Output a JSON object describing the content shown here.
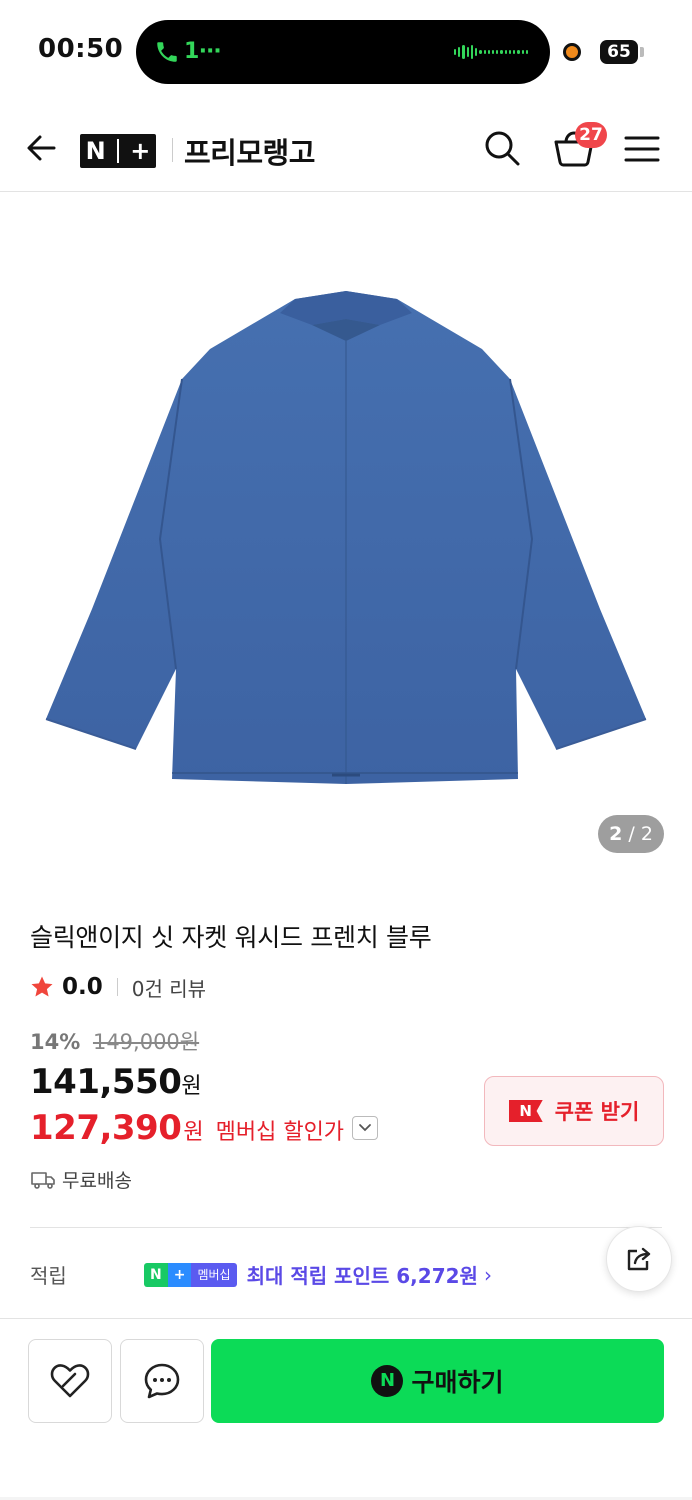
{
  "status_bar": {
    "time": "00:50",
    "call_text": "1⋯",
    "battery": "65"
  },
  "header": {
    "logo": "N+",
    "store_name": "프리모랭고",
    "cart_count": "27"
  },
  "gallery": {
    "current": "2",
    "separator": "/",
    "total": "2"
  },
  "product": {
    "title": "슬릭앤이지 싯 자켓 워시드 프렌치 블루",
    "rating": "0.0",
    "review_count": "0건 리뷰",
    "discount_rate": "14%",
    "original_price": "149,000원",
    "sale_price": "141,550",
    "sale_unit": "원",
    "member_price": "127,390",
    "member_unit": "원",
    "member_label": "멤버십 할인가",
    "shipping": "무료배송"
  },
  "coupon": {
    "badge": "N",
    "label": "쿠폰 받기"
  },
  "points": {
    "label": "적립",
    "badge_n": "N",
    "badge_plus": "+",
    "badge_member": "멤버십",
    "text": "최대 적립 포인트 6,272원",
    "chevron": "›"
  },
  "bottom_bar": {
    "buy_badge": "N",
    "buy_label": "구매하기"
  },
  "colors": {
    "accent_green": "#0cdb57",
    "price_red": "#e5202b",
    "points_purple": "#5a49e6",
    "jacket_blue": "#3f67a8"
  },
  "icons": [
    "back-arrow-icon",
    "search-icon",
    "cart-icon",
    "menu-icon",
    "star-icon",
    "truck-icon",
    "share-icon",
    "heart-icon",
    "chat-icon"
  ]
}
